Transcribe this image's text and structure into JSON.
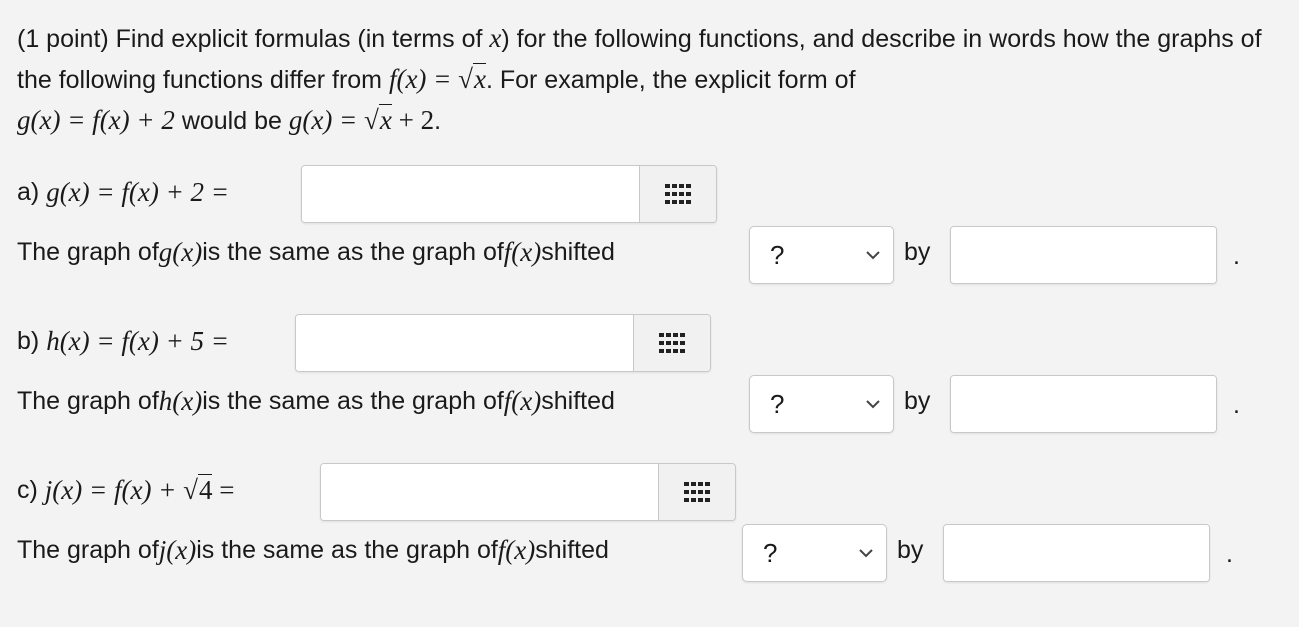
{
  "intro": {
    "p1": "(1 point) Find explicit formulas (in terms of ",
    "x": "x",
    "p2": ") for the following functions, and describe in words how the graphs of the following functions differ from ",
    "fx": "f(x) = ",
    "sqrtx": "x",
    "p3": ". For example, the explicit form of ",
    "ex1": "g(x) = f(x) + 2",
    "p4": " would be ",
    "ex2": "g(x) = ",
    "ex2_sqrt": "x",
    "ex2_tail": " + 2",
    "p5": "."
  },
  "parts": [
    {
      "label": "a) ",
      "formula": "g(x) = f(x) + 2 =",
      "sentence_pre": "The graph of ",
      "fn": "g(x)",
      "sentence_mid": " is the same as the graph of ",
      "fref": "f(x)",
      "sentence_post": " shifted",
      "select_value": "?",
      "by_label": "by",
      "period": "."
    },
    {
      "label": "b) ",
      "formula": "h(x) = f(x) + 5 =",
      "sentence_pre": "The graph of ",
      "fn": "h(x)",
      "sentence_mid": " is the same as the graph of ",
      "fref": "f(x)",
      "sentence_post": " shifted",
      "select_value": "?",
      "by_label": "by",
      "period": "."
    },
    {
      "label": "c) ",
      "formula_pre": "j(x) = f(x) + ",
      "formula_rad": "4",
      "formula_post": " =",
      "sentence_pre": "The graph of ",
      "fn": "j(x)",
      "sentence_mid": " is the same as the graph of ",
      "fref": "f(x)",
      "sentence_post": " shifted",
      "select_value": "?",
      "by_label": "by",
      "period": "."
    }
  ],
  "icons": {
    "keypad": "keypad-icon",
    "dropdown": "chevron-down-icon"
  }
}
